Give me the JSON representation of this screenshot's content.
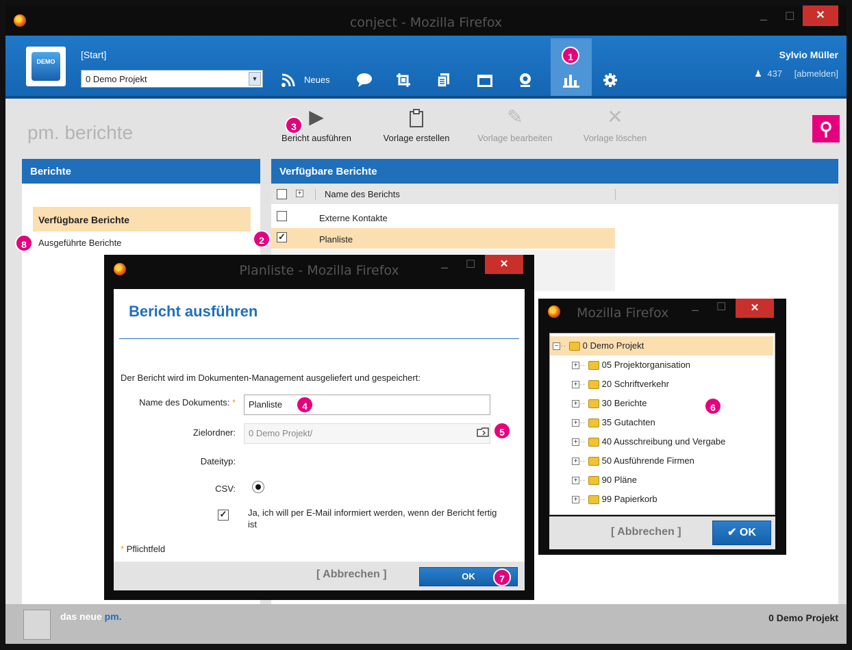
{
  "window": {
    "title": "conject - Mozilla Firefox"
  },
  "appbar": {
    "start_label": "[Start]",
    "project_select": "0 Demo Projekt",
    "logo_text": "DEMO",
    "neues_label": "Neues",
    "user_name": "Sylvio Müller",
    "user_count": "437",
    "logout": "[abmelden]"
  },
  "page": {
    "title_prefix": "pm.",
    "title": "berichte"
  },
  "toolbar": {
    "run": "Bericht ausführen",
    "create": "Vorlage erstellen",
    "edit": "Vorlage bearbeiten",
    "delete": "Vorlage löschen"
  },
  "left_panel": {
    "header": "Berichte",
    "items": [
      "Verfügbare Berichte",
      "Ausgeführte Berichte"
    ]
  },
  "right_panel": {
    "header": "Verfügbare Berichte",
    "column": "Name des Berichts",
    "rows": [
      "Externe Kontakte",
      "Planliste"
    ]
  },
  "footer": {
    "brand_pre": "das neue",
    "brand_pm": "pm",
    "brand_dot": ".",
    "project": "0 Demo Projekt"
  },
  "dialog_run": {
    "window_title": "Planliste - Mozilla Firefox",
    "heading": "Bericht ausführen",
    "intro": "Der Bericht wird im Dokumenten-Management ausgeliefert und gespeichert:",
    "name_label": "Name des Dokuments:",
    "name_value": "Planliste",
    "folder_label": "Zielordner:",
    "folder_value": "0 Demo Projekt/",
    "filetype_label": "Dateityp:",
    "csv_label": "CSV:",
    "email_text": "Ja, ich will per E-Mail informiert werden, wenn der Bericht fertig ist",
    "required_note": "Pflichtfeld",
    "cancel": "[ Abbrechen ]",
    "ok": "OK"
  },
  "dialog_folder": {
    "window_title": "Mozilla Firefox",
    "root": "0 Demo Projekt",
    "children": [
      "05 Projektorganisation",
      "20 Schriftverkehr",
      "30 Berichte",
      "35 Gutachten",
      "40 Ausschreibung und Vergabe",
      "50 Ausführende Firmen",
      "90 Pläne",
      "99 Papierkorb"
    ],
    "cancel": "[ Abbrechen ]",
    "ok": "OK"
  },
  "badges": [
    "1",
    "2",
    "3",
    "4",
    "5",
    "6",
    "7",
    "8"
  ],
  "colors": {
    "accent": "#1f6fba",
    "badge": "#e5007d",
    "selection": "#fbdfb1"
  }
}
